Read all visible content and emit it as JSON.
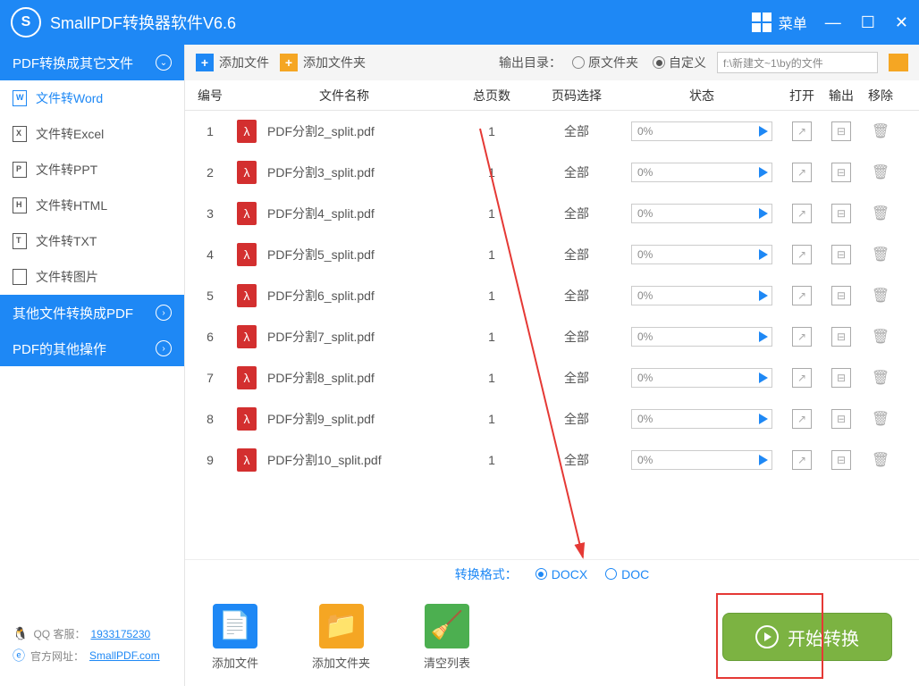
{
  "app": {
    "title": "SmallPDF转换器软件V6.6",
    "menu": "菜单"
  },
  "sidebar": {
    "header1": "PDF转换成其它文件",
    "items": [
      {
        "label": "文件转Word",
        "letter": "W"
      },
      {
        "label": "文件转Excel",
        "letter": "X"
      },
      {
        "label": "文件转PPT",
        "letter": "P"
      },
      {
        "label": "文件转HTML",
        "letter": "H"
      },
      {
        "label": "文件转TXT",
        "letter": "T"
      },
      {
        "label": "文件转图片",
        "letter": ""
      }
    ],
    "header2": "其他文件转换成PDF",
    "header3": "PDF的其他操作",
    "qq_label": "QQ 客服：",
    "qq_num": "1933175230",
    "site_label": "官方网址：",
    "site_url": "SmallPDF.com"
  },
  "toolbar": {
    "add_file": "添加文件",
    "add_folder": "添加文件夹",
    "output_label": "输出目录：",
    "opt_same": "原文件夹",
    "opt_custom": "自定义",
    "path": "f:\\新建文~1\\by的文件"
  },
  "columns": {
    "num": "编号",
    "name": "文件名称",
    "pages": "总页数",
    "range": "页码选择",
    "status": "状态",
    "open": "打开",
    "output": "输出",
    "del": "移除"
  },
  "rows": [
    {
      "num": "1",
      "name": "PDF分割2_split.pdf",
      "pages": "1",
      "range": "全部",
      "pct": "0%"
    },
    {
      "num": "2",
      "name": "PDF分割3_split.pdf",
      "pages": "1",
      "range": "全部",
      "pct": "0%"
    },
    {
      "num": "3",
      "name": "PDF分割4_split.pdf",
      "pages": "1",
      "range": "全部",
      "pct": "0%"
    },
    {
      "num": "4",
      "name": "PDF分割5_split.pdf",
      "pages": "1",
      "range": "全部",
      "pct": "0%"
    },
    {
      "num": "5",
      "name": "PDF分割6_split.pdf",
      "pages": "1",
      "range": "全部",
      "pct": "0%"
    },
    {
      "num": "6",
      "name": "PDF分割7_split.pdf",
      "pages": "1",
      "range": "全部",
      "pct": "0%"
    },
    {
      "num": "7",
      "name": "PDF分割8_split.pdf",
      "pages": "1",
      "range": "全部",
      "pct": "0%"
    },
    {
      "num": "8",
      "name": "PDF分割9_split.pdf",
      "pages": "1",
      "range": "全部",
      "pct": "0%"
    },
    {
      "num": "9",
      "name": "PDF分割10_split.pdf",
      "pages": "1",
      "range": "全部",
      "pct": "0%"
    }
  ],
  "format": {
    "label": "转换格式：",
    "docx": "DOCX",
    "doc": "DOC"
  },
  "bottom": {
    "add_file": "添加文件",
    "add_folder": "添加文件夹",
    "clear": "清空列表",
    "start": "开始转换"
  }
}
